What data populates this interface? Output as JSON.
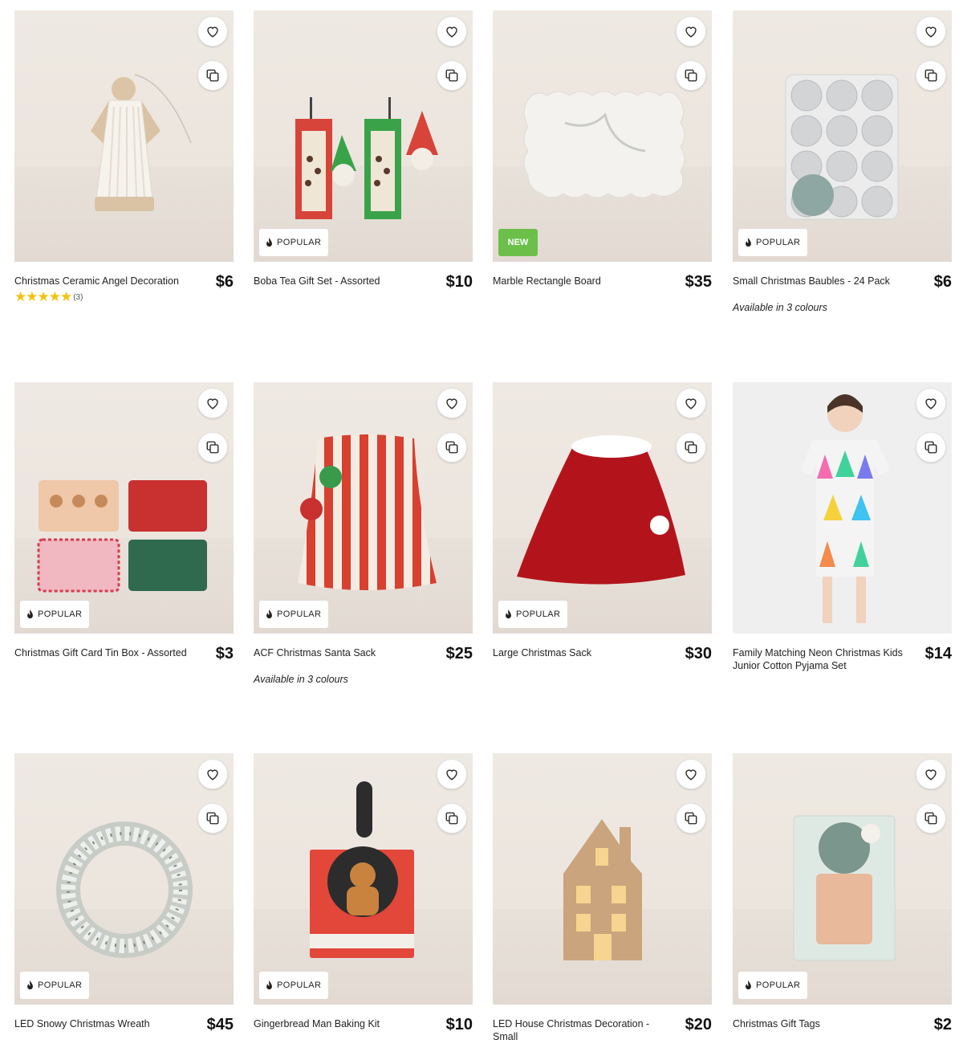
{
  "badges": {
    "popular": "POPULAR",
    "new": "NEW"
  },
  "products": [
    {
      "name": "Christmas Ceramic Angel Decoration",
      "price": "$6",
      "rating": {
        "stars": "★★★★★",
        "count": "(3)"
      }
    },
    {
      "name": "Boba Tea Gift Set - Assorted",
      "price": "$10",
      "badge": "POPULAR"
    },
    {
      "name": "Marble Rectangle Board",
      "price": "$35",
      "badge": "NEW"
    },
    {
      "name": "Small Christmas Baubles - 24 Pack",
      "price": "$6",
      "badge": "POPULAR",
      "colours": "Available in 3 colours"
    },
    {
      "name": "Christmas Gift Card Tin Box - Assorted",
      "price": "$3",
      "badge": "POPULAR"
    },
    {
      "name": "ACF Christmas Santa Sack",
      "price": "$25",
      "badge": "POPULAR",
      "colours": "Available in 3 colours"
    },
    {
      "name": "Large Christmas Sack",
      "price": "$30",
      "badge": "POPULAR"
    },
    {
      "name": "Family Matching Neon Christmas Kids Junior Cotton Pyjama Set",
      "price": "$14"
    },
    {
      "name": "LED Snowy Christmas Wreath",
      "price": "$45",
      "badge": "POPULAR"
    },
    {
      "name": "Gingerbread Man Baking Kit",
      "price": "$10",
      "badge": "POPULAR"
    },
    {
      "name": "LED House Christmas Decoration - Small",
      "price": "$20"
    },
    {
      "name": "Christmas Gift Tags",
      "price": "$2",
      "badge": "POPULAR"
    }
  ],
  "colors": {
    "new_badge": "#6cc04a",
    "star": "#f4c20d"
  },
  "icons": {
    "favourite": "heart-icon",
    "compare": "compare-icon",
    "popular": "flame-icon"
  }
}
